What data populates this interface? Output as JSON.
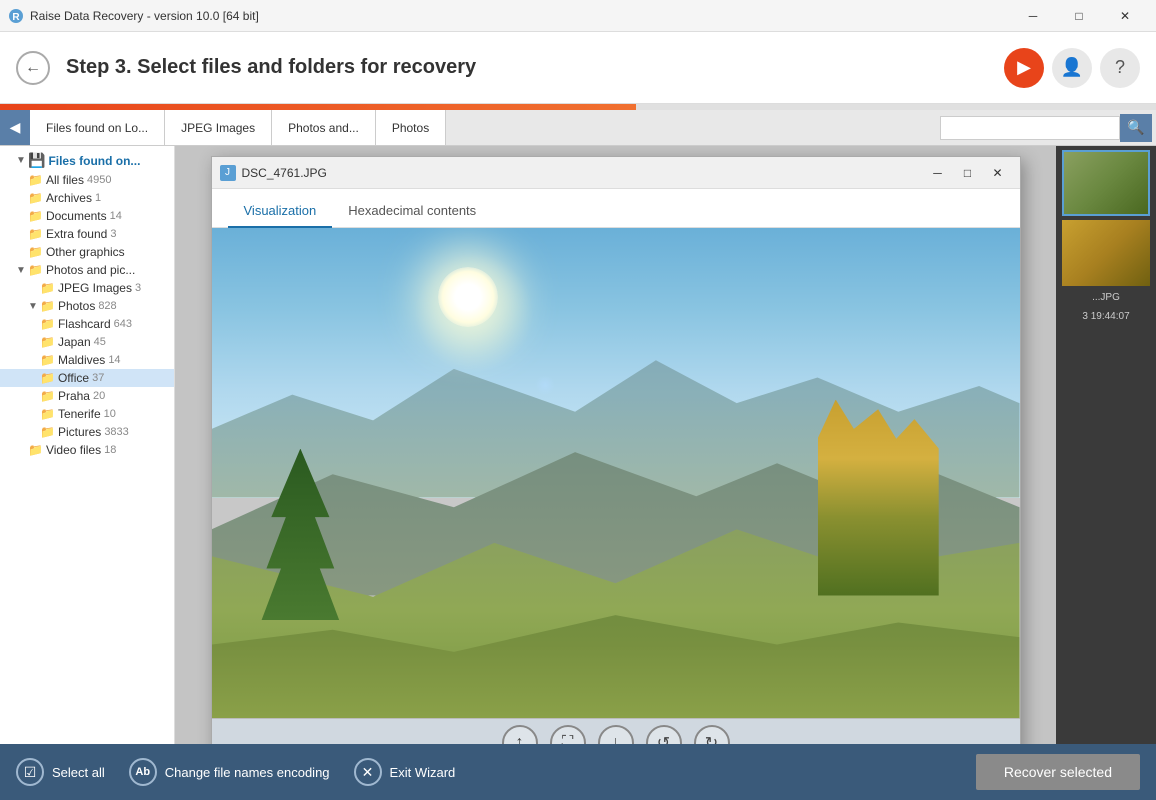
{
  "app": {
    "title": "Raise Data Recovery - version 10.0 [64 bit]",
    "icon": "R"
  },
  "titlebar": {
    "minimize": "─",
    "maximize": "□",
    "close": "✕"
  },
  "header": {
    "step": "Step 3.",
    "description": "Select files and folders for recovery",
    "back_label": "←"
  },
  "tabs": [
    {
      "label": "Files found on Lo..."
    },
    {
      "label": "JPEG Images"
    },
    {
      "label": "Photos and..."
    },
    {
      "label": "Photos"
    }
  ],
  "sidebar": {
    "root_label": "Files found on...",
    "items": [
      {
        "label": "All files",
        "count": "4950",
        "depth": 0,
        "expanded": true
      },
      {
        "label": "Archives",
        "count": "1",
        "depth": 0
      },
      {
        "label": "Documents",
        "count": "14",
        "depth": 0
      },
      {
        "label": "Extra found",
        "count": "3",
        "depth": 0
      },
      {
        "label": "Other graphics",
        "count": "",
        "depth": 0
      },
      {
        "label": "Photos and pic...",
        "count": "",
        "depth": 0,
        "expanded": true
      },
      {
        "label": "JPEG Images",
        "count": "3",
        "depth": 1
      },
      {
        "label": "Photos",
        "count": "828",
        "depth": 1,
        "expanded": true
      },
      {
        "label": "Flashcard",
        "count": "643",
        "depth": 2
      },
      {
        "label": "Japan",
        "count": "45",
        "depth": 2
      },
      {
        "label": "Maldives",
        "count": "14",
        "depth": 2
      },
      {
        "label": "Office",
        "count": "37",
        "depth": 2
      },
      {
        "label": "Praha",
        "count": "20",
        "depth": 2
      },
      {
        "label": "Tenerife",
        "count": "10",
        "depth": 2
      },
      {
        "label": "Pictures",
        "count": "3833",
        "depth": 1
      },
      {
        "label": "Video files",
        "count": "18",
        "depth": 0
      }
    ]
  },
  "modal": {
    "title": "DSC_4761.JPG",
    "tabs": [
      {
        "label": "Visualization",
        "active": true
      },
      {
        "label": "Hexadecimal contents",
        "active": false
      }
    ],
    "controls": {
      "minimize": "─",
      "maximize": "□",
      "close": "✕"
    },
    "toolbar_buttons": [
      {
        "icon": "↑",
        "name": "scroll-up"
      },
      {
        "icon": "⛶",
        "name": "fit-screen"
      },
      {
        "icon": "↓",
        "name": "scroll-down"
      },
      {
        "icon": "↺",
        "name": "rotate-left"
      },
      {
        "icon": "↻",
        "name": "rotate-right"
      }
    ]
  },
  "preview": {
    "filename": "...JPG",
    "datetime": "3 19:44:07"
  },
  "bottombar": {
    "select_all_label": "Select all",
    "change_encoding_label": "Change file names encoding",
    "exit_wizard_label": "Exit Wizard",
    "recover_label": "Recover selected"
  }
}
